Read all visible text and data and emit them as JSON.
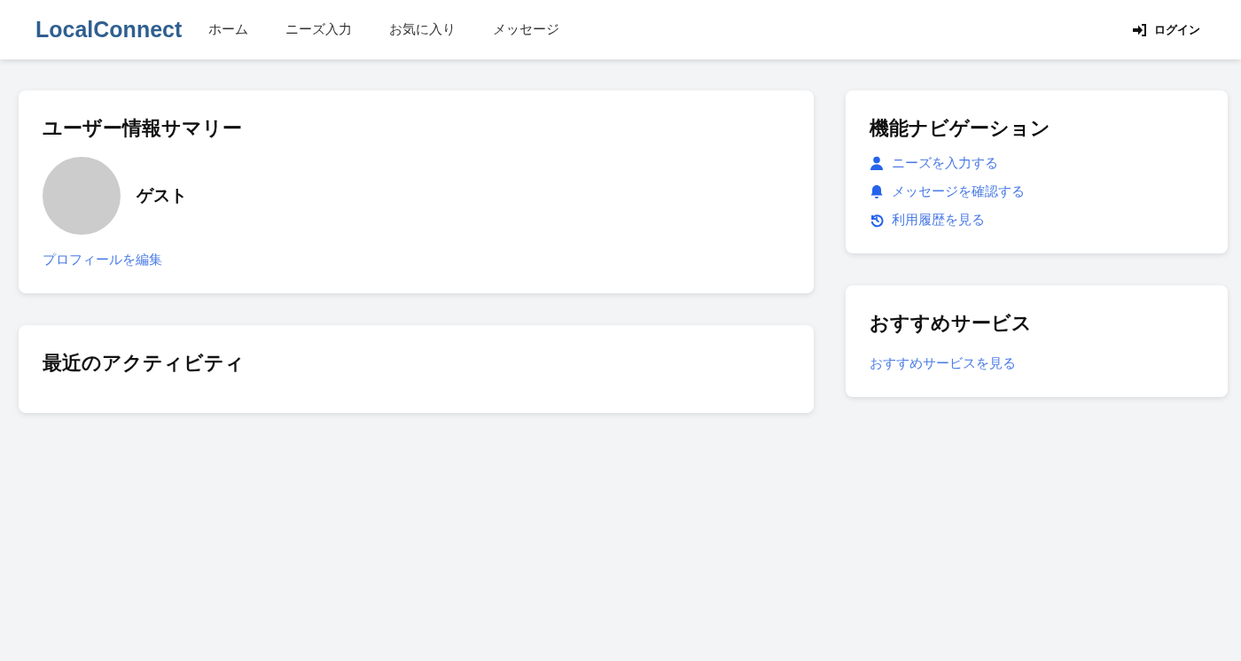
{
  "header": {
    "logo": "LocalConnect",
    "nav": [
      "ホーム",
      "ニーズ入力",
      "お気に入り",
      "メッセージ"
    ],
    "login": "ログイン"
  },
  "user_summary": {
    "title": "ユーザー情報サマリー",
    "name": "ゲスト",
    "edit_link": "プロフィールを編集"
  },
  "recent_activity": {
    "title": "最近のアクティビティ"
  },
  "feature_nav": {
    "title": "機能ナビゲーション",
    "links": [
      {
        "kind": "user",
        "label": "ニーズを入力する"
      },
      {
        "kind": "bell",
        "label": "メッセージを確認する"
      },
      {
        "kind": "history",
        "label": "利用履歴を見る"
      }
    ]
  },
  "recommended": {
    "title": "おすすめサービス",
    "link": "おすすめサービスを見る"
  }
}
